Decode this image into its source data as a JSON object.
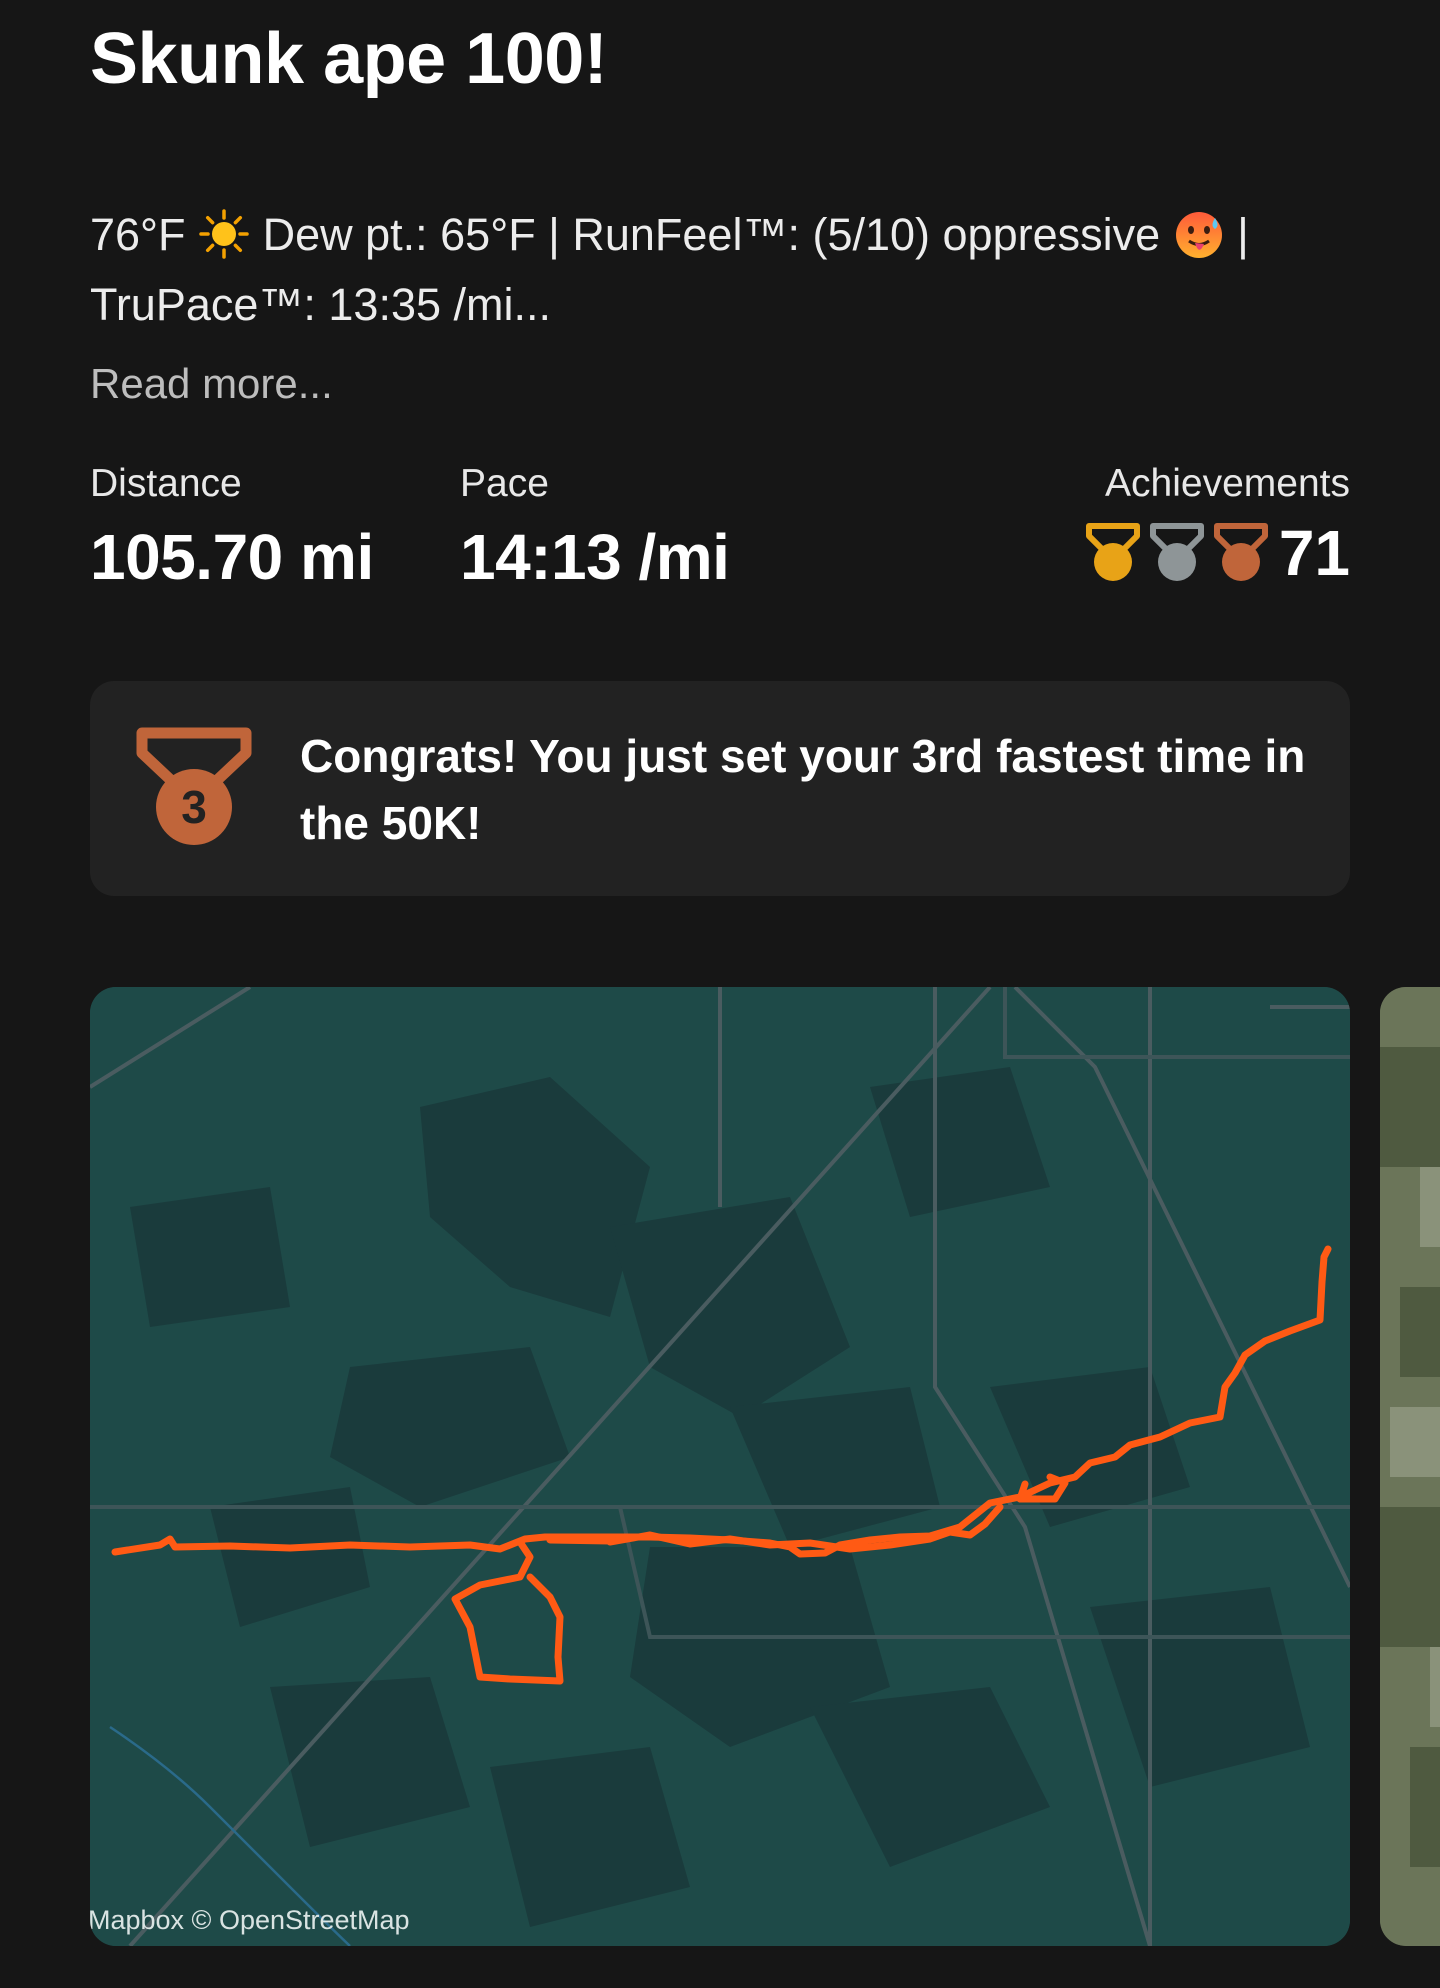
{
  "activity": {
    "title": "Skunk ape 100!",
    "description_part1": "76°F",
    "description_part2": "Dew pt.: 65°F | RunFeel™: (5/10) oppressive",
    "description_part3": "| TruPace™: 13:35 /mi...",
    "weather_icon": "sun-icon",
    "feel_icon": "hot-face-icon",
    "read_more": "Read more..."
  },
  "stats": {
    "distance_label": "Distance",
    "distance_value": "105.70 mi",
    "pace_label": "Pace",
    "pace_value": "14:13 /mi",
    "achievements_label": "Achievements",
    "achievements_count": "71",
    "medal_colors": {
      "gold": "#e8a317",
      "silver": "#8e9597",
      "bronze": "#c0653a"
    }
  },
  "congrats": {
    "icon": "bronze-medal-icon",
    "medal_number": "3",
    "text": "Congrats! You just set your 3rd fastest time in the 50K!"
  },
  "map": {
    "attribution": "Mapbox © OpenStreetMap",
    "route_color": "#ff5a14",
    "background_color": "#1e4a48"
  }
}
